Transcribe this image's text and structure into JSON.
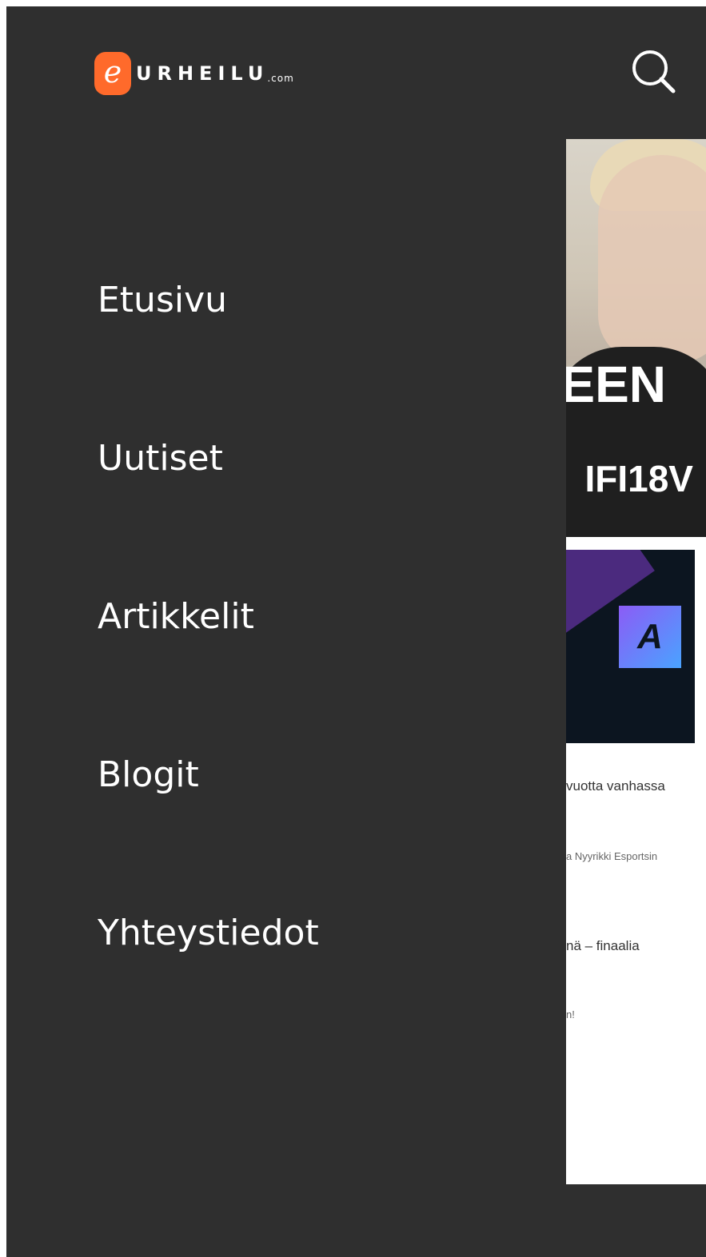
{
  "header": {
    "logo_letter": "e",
    "logo_word": "URHEILU",
    "logo_tld": ".com",
    "search_icon": "search-icon"
  },
  "menu": {
    "items": [
      {
        "label": "Etusivu"
      },
      {
        "label": "Uutiset"
      },
      {
        "label": "Artikkelit"
      },
      {
        "label": "Blogit"
      },
      {
        "label": "Yhteystiedot"
      }
    ]
  },
  "preview": {
    "hero_text_1": "EEN",
    "hero_text_2": "IFI18V",
    "banner_logo": "A",
    "snippets": [
      "vuotta vanhassa",
      "a Nyyrikki Esportsin",
      "nä – finaalia",
      "n!"
    ]
  },
  "colors": {
    "drawer_bg": "#2f2f2f",
    "brand": "#ff6a2b",
    "text": "#ffffff"
  }
}
